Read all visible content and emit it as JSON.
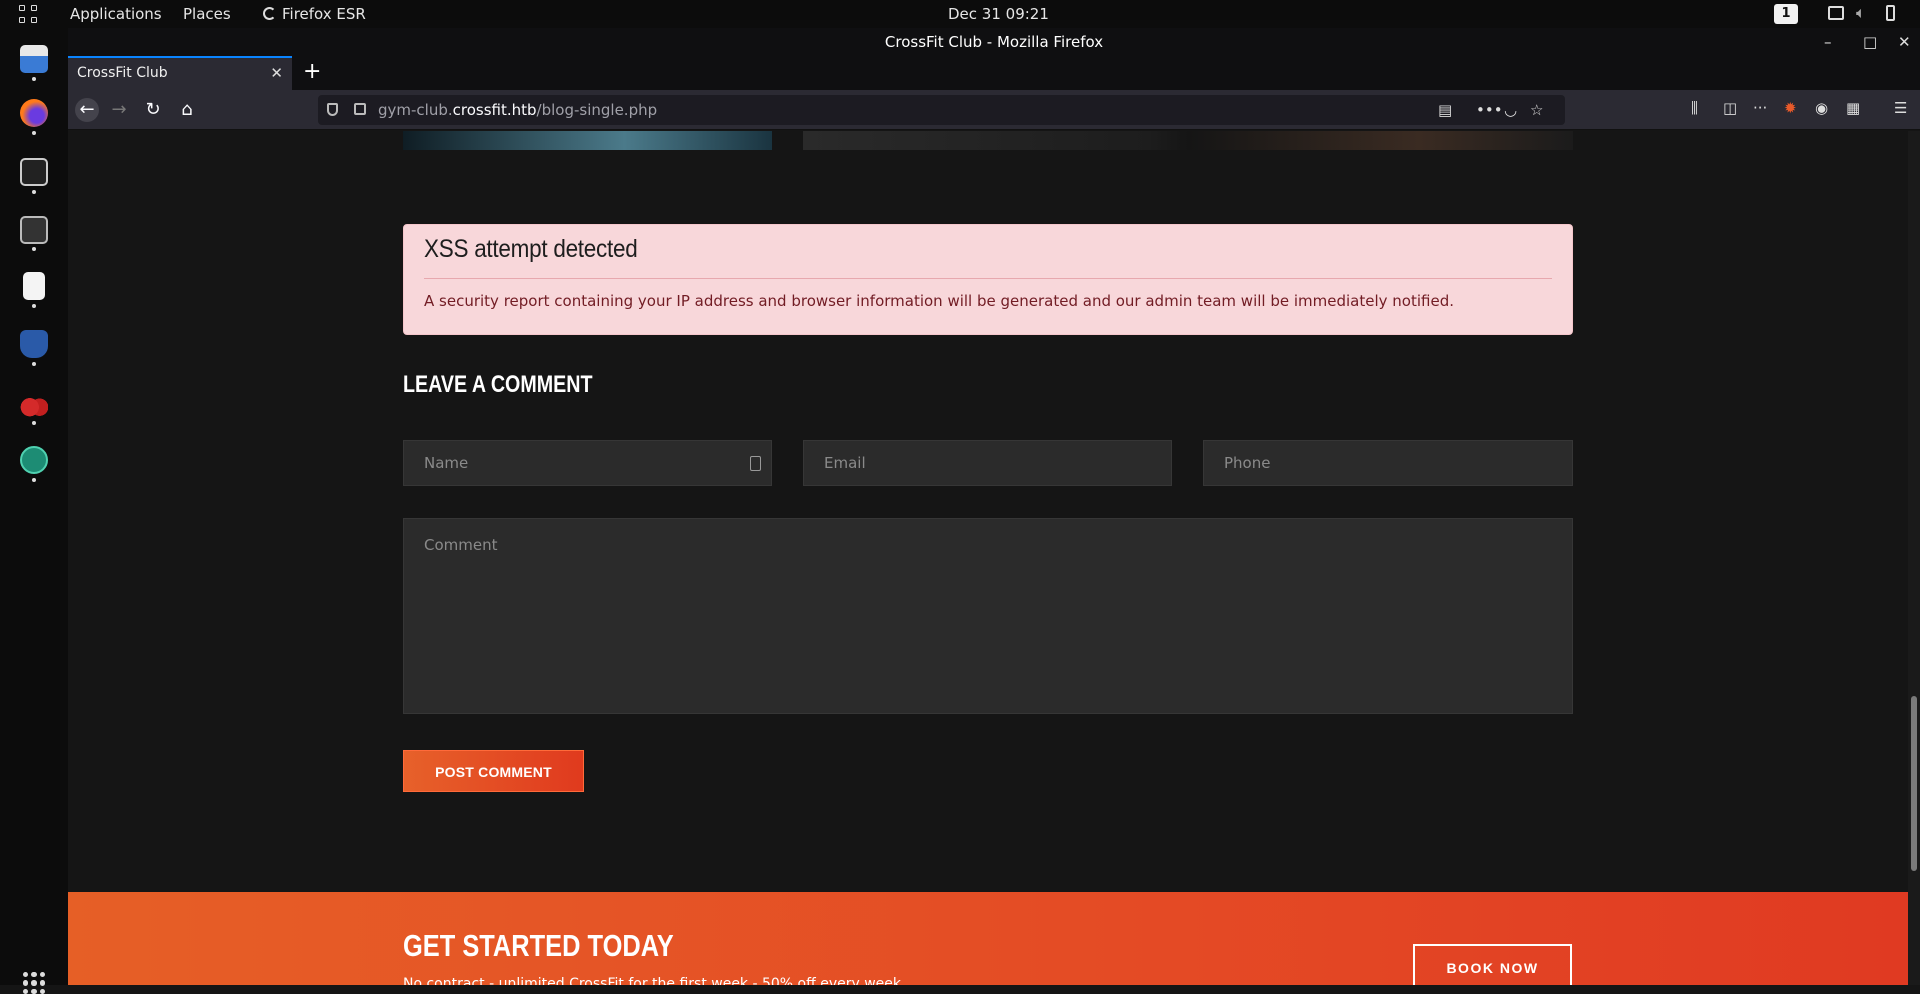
{
  "topbar": {
    "applications": "Applications",
    "places": "Places",
    "browser": "Firefox ESR",
    "clock": "Dec 31  09:21",
    "workspace": "1"
  },
  "window": {
    "title": "CrossFit Club - Mozilla Firefox"
  },
  "tab": {
    "title": "CrossFit Club",
    "close": "✕"
  },
  "address": {
    "host_prefix": "gym-club.",
    "host_domain": "crossfit.htb",
    "path": "/blog-single.php"
  },
  "alert": {
    "title": "XSS attempt detected",
    "message": "A security report containing your IP address and browser information will be generated and our admin team will be immediately notified."
  },
  "comment_form": {
    "title": "LEAVE A COMMENT",
    "name_placeholder": "Name",
    "email_placeholder": "Email",
    "phone_placeholder": "Phone",
    "comment_placeholder": "Comment",
    "submit_label": "POST COMMENT"
  },
  "cta": {
    "title": "GET STARTED TODAY",
    "subtitle": "No contract - unlimited CrossFit for the first week - 50% off every week",
    "button": "BOOK NOW"
  },
  "colors": {
    "accent": "#e4502a",
    "alert_bg": "#f8d7da",
    "alert_text": "#721c24"
  }
}
